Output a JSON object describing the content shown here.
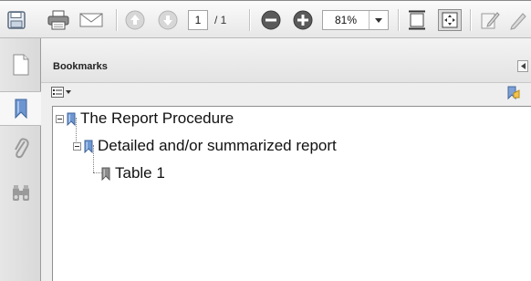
{
  "toolbar": {
    "buttons": [
      "save-icon",
      "print-icon",
      "email-icon",
      "previous-page-icon",
      "next-page-icon",
      "zoom-out-icon",
      "zoom-in-icon",
      "fit-page-icon",
      "fit-width-icon",
      "comment-icon",
      "sign-icon"
    ],
    "page_current": "1",
    "page_total": "/ 1",
    "zoom": "81%"
  },
  "nav": {
    "items": [
      "pages-icon",
      "bookmarks-icon",
      "attachments-icon",
      "search-icon"
    ],
    "active": "bookmarks-icon"
  },
  "panel": {
    "title": "Bookmarks"
  },
  "bookmarks": [
    {
      "label": "The Report Procedure",
      "level": 0,
      "expanded": true
    },
    {
      "label": "Detailed and/or summarized report",
      "level": 1,
      "expanded": true
    },
    {
      "label": "Table 1",
      "level": 2,
      "expanded": false
    }
  ],
  "colors": {
    "bookmark_blue": "#4a78b8",
    "bookmark_gray": "#8c8c8c",
    "icon_blue": "#3a76c4"
  }
}
